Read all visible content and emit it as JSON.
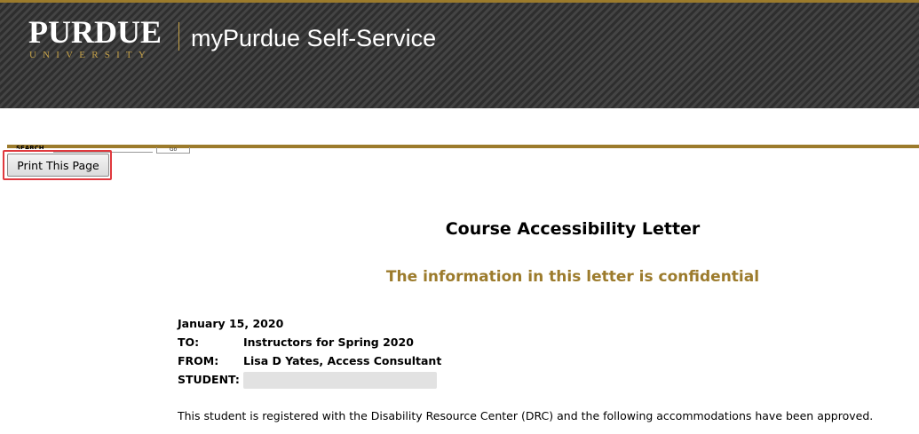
{
  "header": {
    "logo_wordmark": "PURDUE",
    "logo_subtext": "UNIVERSITY",
    "site_title": "myPurdue Self-Service"
  },
  "clipped_search": {
    "label": "SEARCH",
    "go_label": "Go"
  },
  "toolbar": {
    "print_label": "Print This Page"
  },
  "letter": {
    "title": "Course Accessibility Letter",
    "confidential_notice": "The information in this letter is confidential",
    "date": "January 15, 2020",
    "to_label": "TO:",
    "to_value": "Instructors for Spring 2020",
    "from_label": "FROM:",
    "from_value": "Lisa D Yates, Access Consultant",
    "student_label": "STUDENT:",
    "intro": "This student is registered with the Disability Resource Center (DRC) and the following accommodations have been approved."
  },
  "colors": {
    "gold": "#9c7b2c",
    "header_dark": "#3a3a3a",
    "highlight_red": "#e0393e"
  }
}
